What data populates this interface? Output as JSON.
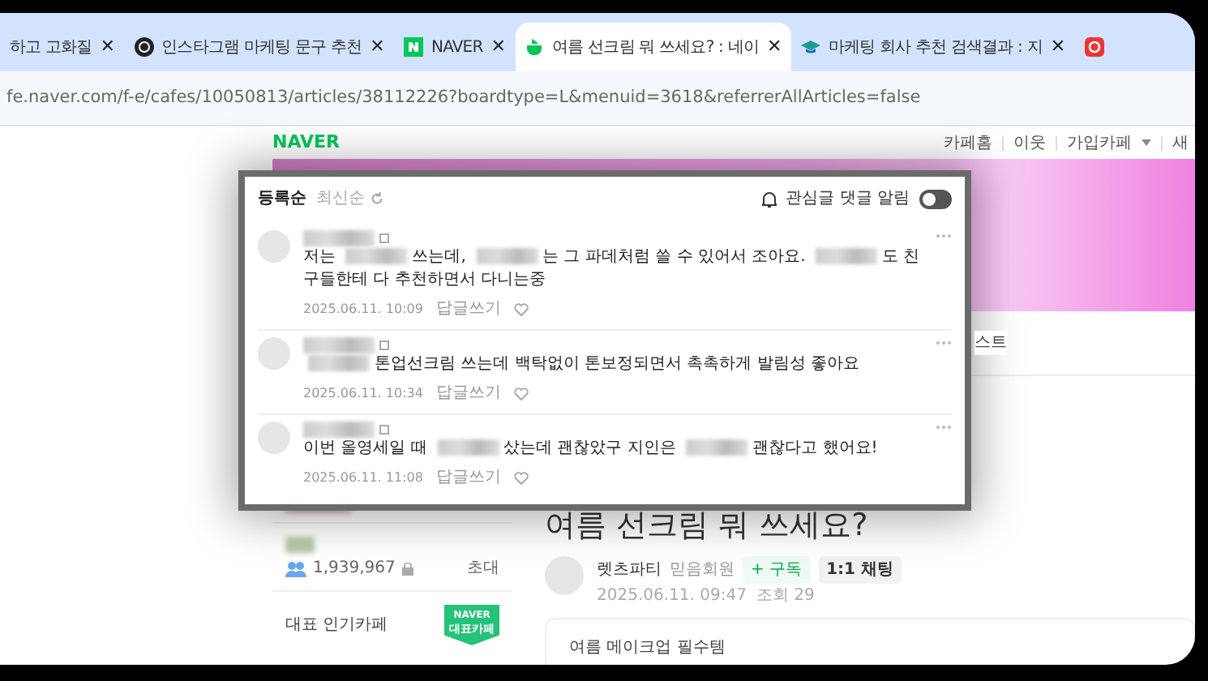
{
  "browser": {
    "tabs": [
      {
        "title": "하고 고화질",
        "selected": false,
        "close": "✕"
      },
      {
        "title": "인스타그램 마케팅 문구 추천",
        "selected": false,
        "close": "✕"
      },
      {
        "title": "NAVER",
        "selected": false,
        "close": "✕"
      },
      {
        "title": "여름 선크림 뭐 쓰세요? : 네이",
        "selected": true,
        "close": "✕"
      },
      {
        "title": "마케팅 회사 추천 검색결과 : 지",
        "selected": false,
        "close": "✕"
      },
      {
        "selected": false
      }
    ],
    "url": "fe.naver.com/f-e/cafes/10050813/articles/38112226?boardtype=L&menuid=3618&referrerAllArticles=false"
  },
  "cafe": {
    "logo": "NAVER",
    "nav": [
      "카페홈",
      "이웃",
      "가입카페",
      "새"
    ],
    "menu_tab": "스트",
    "sidebar": {
      "member_count": "1,939,967",
      "invite": "초대",
      "popular_label": "대표 인기카페",
      "badge_top": "NAVER",
      "badge_bottom": "대표카페"
    },
    "article": {
      "title": "여름 선크림 뭐 쓰세요?",
      "author": "렛츠파티",
      "grade": "믿음회원",
      "subscribe": "+ 구독",
      "chat": "1:1 채팅",
      "date": "2025.06.11. 09:47",
      "views": "조회 29",
      "body": "여름 메이크업 필수템"
    }
  },
  "comments_popup": {
    "sort_options": [
      {
        "label": "등록순",
        "selected": true
      },
      {
        "label": "최신순",
        "selected": false
      }
    ],
    "notify_label": "관심글 댓글 알림",
    "notify_on": false,
    "comments": [
      {
        "segments": [
          {
            "kind": "text",
            "text": "저는"
          },
          {
            "kind": "blur"
          },
          {
            "kind": "text",
            "text": "쓰는데,"
          },
          {
            "kind": "blur"
          },
          {
            "kind": "text",
            "text": "는 그 파데처럼 쓸 수 있어서 조아요."
          },
          {
            "kind": "blur"
          },
          {
            "kind": "text",
            "text": "도 친구들한테 다 추천하면서 다니는중"
          }
        ],
        "date": "2025.06.11. 10:09",
        "reply": "답글쓰기"
      },
      {
        "segments": [
          {
            "kind": "blur"
          },
          {
            "kind": "text",
            "text": "톤업선크림 쓰는데 백탁없이 톤보정되면서 촉촉하게 발림성 좋아요"
          }
        ],
        "date": "2025.06.11. 10:34",
        "reply": "답글쓰기"
      },
      {
        "segments": [
          {
            "kind": "text",
            "text": "이번 올영세일 때"
          },
          {
            "kind": "blur"
          },
          {
            "kind": "text",
            "text": "샀는데 괜찮았구 지인은"
          },
          {
            "kind": "blur"
          },
          {
            "kind": "text",
            "text": "괜찮다고 했어요!"
          }
        ],
        "date": "2025.06.11. 11:08",
        "reply": "답글쓰기"
      }
    ]
  }
}
